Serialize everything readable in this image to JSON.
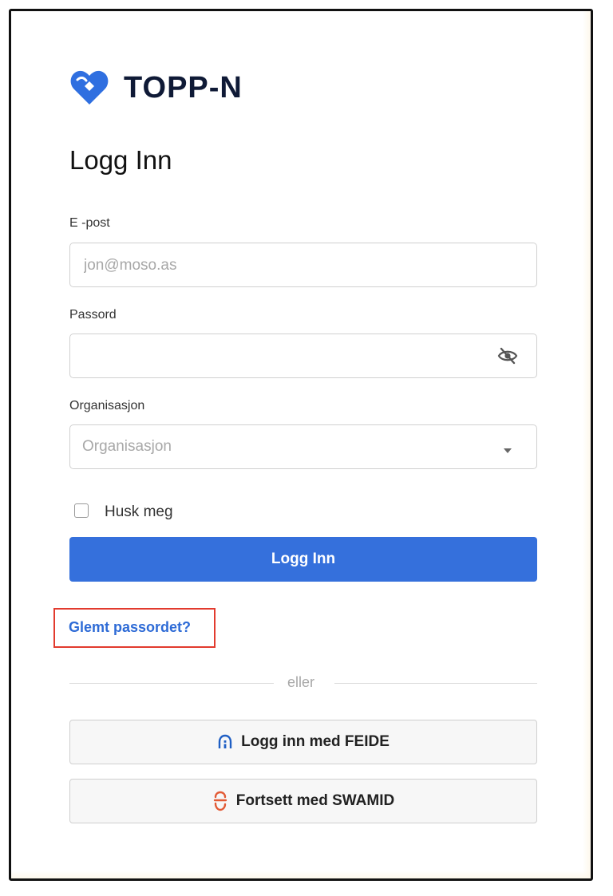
{
  "brand": {
    "name": "TOPP-N",
    "logo_icon": "heart-logo-icon",
    "logo_color": "#2f6fe0"
  },
  "login": {
    "title": "Logg Inn",
    "email": {
      "label": "E -post",
      "placeholder": "jon@moso.as",
      "value": ""
    },
    "password": {
      "label": "Passord",
      "value": "",
      "toggle_icon": "eye-slash-icon"
    },
    "organization": {
      "label": "Organisasjon",
      "placeholder": "Organisasjon",
      "icon": "caret-down-icon"
    },
    "remember": {
      "label": "Husk meg",
      "checked": false
    },
    "submit_label": "Logg Inn",
    "forgot_label": "Glemt passordet?",
    "divider_label": "eller",
    "feide_label": "Logg inn med FEIDE",
    "feide_icon": "feide-icon",
    "swamid_label": "Fortsett med SWAMID",
    "swamid_icon": "swamid-icon"
  },
  "colors": {
    "primary": "#3570dc",
    "link": "#2e6bd6",
    "highlight": "#e23b2e",
    "swamid": "#e25a35"
  }
}
